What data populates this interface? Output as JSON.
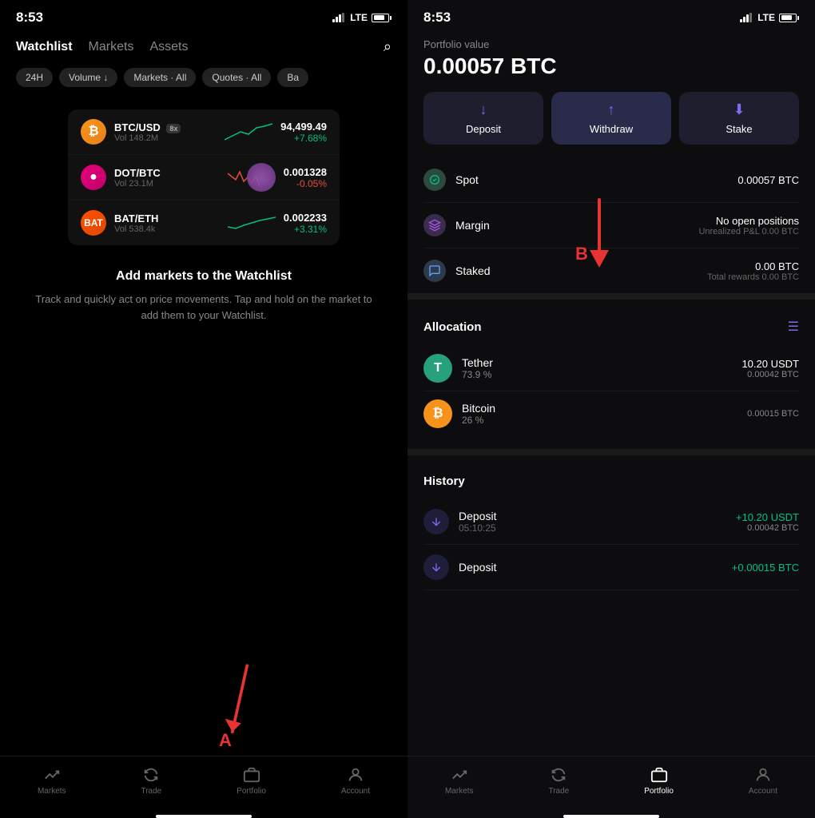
{
  "left": {
    "status": {
      "time": "8:53",
      "signal": "LTE"
    },
    "nav": {
      "tabs": [
        {
          "label": "Watchlist",
          "active": true
        },
        {
          "label": "Markets",
          "active": false
        },
        {
          "label": "Assets",
          "active": false
        }
      ],
      "search_icon": "🔍"
    },
    "filters": [
      {
        "label": "24H"
      },
      {
        "label": "Volume ↓"
      },
      {
        "label": "Markets · All"
      },
      {
        "label": "Quotes · All"
      },
      {
        "label": "Ba"
      }
    ],
    "markets": [
      {
        "pair": "BTC/USD",
        "badge": "8x",
        "volume": "Vol 148.2M",
        "price": "94,499.49",
        "change": "+7.68%",
        "positive": true,
        "icon": "₿",
        "color": "#f7931a"
      },
      {
        "pair": "DOT/BTC",
        "badge": "",
        "volume": "Vol 23.1M",
        "price": "0.001328",
        "change": "-0.05%",
        "positive": false,
        "icon": "●",
        "color": "#e6007a"
      },
      {
        "pair": "BAT/ETH",
        "badge": "",
        "volume": "Vol 538.4k",
        "price": "0.002233",
        "change": "+3.31%",
        "positive": true,
        "icon": "🦇",
        "color": "#ff5000"
      }
    ],
    "empty_state": {
      "title": "Add markets to the Watchlist",
      "description": "Track and quickly act on price movements. Tap and hold on the market to add them to your Watchlist."
    },
    "arrow_a_label": "A",
    "bottom_nav": [
      {
        "label": "Markets",
        "active": false,
        "icon": "markets"
      },
      {
        "label": "Trade",
        "active": false,
        "icon": "trade"
      },
      {
        "label": "Portfolio",
        "active": false,
        "icon": "portfolio"
      },
      {
        "label": "Account",
        "active": false,
        "icon": "account"
      }
    ]
  },
  "right": {
    "status": {
      "time": "8:53",
      "signal": "LTE"
    },
    "portfolio": {
      "label": "Portfolio value",
      "value": "0.00057 BTC"
    },
    "actions": [
      {
        "label": "Deposit",
        "icon": "download",
        "active": false
      },
      {
        "label": "Withdraw",
        "icon": "upload",
        "active": true
      },
      {
        "label": "Stake",
        "icon": "stake",
        "active": false
      }
    ],
    "arrow_b_label": "B",
    "balances": [
      {
        "name": "Spot",
        "icon": "spot",
        "value": "0.00057 BTC",
        "sub": ""
      },
      {
        "name": "Margin",
        "icon": "margin",
        "value": "No open positions",
        "sub": "Unrealized P&L 0.00 BTC"
      },
      {
        "name": "Staked",
        "icon": "staked",
        "value": "0.00 BTC",
        "sub": "Total rewards 0.00 BTC"
      }
    ],
    "allocation": {
      "title": "Allocation",
      "items": [
        {
          "name": "Tether",
          "pct": "73.9 %",
          "usdt": "10.20 USDT",
          "btc": "0.00042 BTC",
          "icon": "T",
          "color": "#26a17b"
        },
        {
          "name": "Bitcoin",
          "pct": "26 %",
          "usdt": "",
          "btc": "0.00015 BTC",
          "icon": "₿",
          "color": "#f7931a"
        }
      ]
    },
    "history": {
      "title": "History",
      "items": [
        {
          "type": "Deposit",
          "time": "05:10:25",
          "usdt": "+10.20  USDT",
          "btc": "0.00042 BTC"
        },
        {
          "type": "Deposit",
          "time": "",
          "usdt": "+0.00015 BTC",
          "btc": ""
        }
      ]
    },
    "bottom_nav": [
      {
        "label": "Markets",
        "active": false,
        "icon": "markets"
      },
      {
        "label": "Trade",
        "active": false,
        "icon": "trade"
      },
      {
        "label": "Portfolio",
        "active": true,
        "icon": "portfolio"
      },
      {
        "label": "Account",
        "active": false,
        "icon": "account"
      }
    ]
  }
}
